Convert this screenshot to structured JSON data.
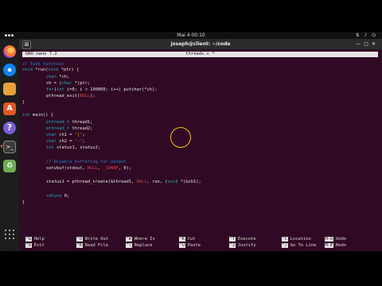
{
  "topbar": {
    "activities": "",
    "clock": "Mai 4  00:10",
    "tray": "⇅ ♪ ⏻"
  },
  "window": {
    "title": "joseph@client: ~/code",
    "minimize": "—",
    "maximize": "□",
    "close": "✕",
    "new_tab": "⊞"
  },
  "nano": {
    "version": "GNU nano 7.2",
    "filename": "threads.c *"
  },
  "code": {
    "l1": "// Task function",
    "l2a": "void",
    "l2b": " *run(",
    "l2c": "void",
    "l2d": " *ptr) {",
    "l3a": "char",
    "l3b": " *ch;",
    "l4a": "ch = (",
    "l4b": "char",
    "l4c": " *)ptr;",
    "l5a": "for",
    "l5b": "(",
    "l5c": "int",
    "l5d": " i=0; i < 100000; i++) putchar(*ch);",
    "l6a": "pthread_exit(",
    "l6b": "NULL",
    "l6c": ");",
    "l7": "}",
    "l8a": "int",
    "l8b": " main() {",
    "l9a": "pthread_t",
    "l9b": " thread1;",
    "l10a": "pthread_t",
    "l10b": " thread2;",
    "l11a": "char",
    "l11b": " ch1 = ",
    "l11c": "'|'",
    "l11d": ";",
    "l12a": "char",
    "l12b": " ch2 = ",
    "l12c": "'-'",
    "l12d": ";",
    "l13a": "int",
    "l13b": " status1, status2;",
    "l14": "// Disable buffering for output",
    "l15a": "setvbuf(stdout, ",
    "l15b": "NULL",
    "l15c": ", ",
    "l15d": "_IONBF",
    "l15e": ", 0);",
    "l16a": "status1 = pthread_create(&thread1, ",
    "l16b": "NULL",
    "l16c": ", run, (",
    "l16d": "void",
    "l16e": " *)&ch1);",
    "l17a": "return",
    "l17b": " 0;",
    "l18": "}"
  },
  "shortcuts": [
    {
      "key": "^G",
      "label": "Help"
    },
    {
      "key": "^O",
      "label": "Write Out"
    },
    {
      "key": "^W",
      "label": "Where Is"
    },
    {
      "key": "^K",
      "label": "Cut"
    },
    {
      "key": "^T",
      "label": "Execute"
    },
    {
      "key": "^C",
      "label": "Location"
    },
    {
      "key": "M-U",
      "label": "Undo"
    },
    {
      "key": "^X",
      "label": "Exit"
    },
    {
      "key": "^R",
      "label": "Read File"
    },
    {
      "key": "^\\",
      "label": "Replace"
    },
    {
      "key": "^U",
      "label": "Paste"
    },
    {
      "key": "^J",
      "label": "Justify"
    },
    {
      "key": "^/",
      "label": "Go To Line"
    },
    {
      "key": "M-E",
      "label": "Redo"
    }
  ],
  "dock": {
    "software_glyph": "A",
    "help_glyph": "?",
    "terminal_glyph": ">_",
    "trash_glyph": "♻"
  },
  "colors": {
    "terminal_bg": "#300a24",
    "accent": "#e95420",
    "click_indicator": "#f0c000"
  }
}
